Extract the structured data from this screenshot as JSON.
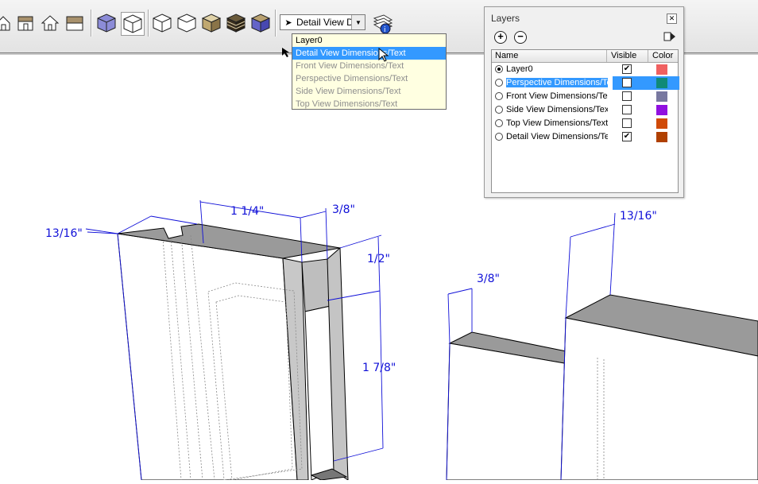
{
  "toolbar": {
    "icons": [
      "house-icon",
      "house-front-icon",
      "house-outline-icon",
      "house-roof-icon",
      "xray-cube-icon",
      "wireframe-cube-icon",
      "hidden-line-cube-icon",
      "hidden-line-cube-icon",
      "shaded-cube-icon",
      "shaded-textures-cube-icon",
      "monochrome-cube-icon",
      "layer-manager-icon"
    ],
    "layer_select_value": "Detail View Di"
  },
  "layer_dropdown": {
    "options": [
      "Layer0",
      "Detail View Dimensions/Text",
      "Front View Dimensions/Text",
      "Perspective Dimensions/Text",
      "Side View Dimensions/Text",
      "Top View Dimensions/Text"
    ],
    "selected": "Detail View Dimensions/Text"
  },
  "layers_window": {
    "title": "Layers",
    "columns": [
      "Name",
      "Visible",
      "Color"
    ],
    "add_icon": "plus-circle-icon",
    "remove_icon": "minus-circle-icon",
    "details_icon": "details-arrow-icon",
    "rows": [
      {
        "name": "Layer0",
        "active": true,
        "visible": true,
        "color": "#f06060"
      },
      {
        "name": "Perspective Dimensions/Te",
        "active": false,
        "visible": false,
        "color": "#0f8a78"
      },
      {
        "name": "Front View Dimensions/Tex",
        "active": false,
        "visible": false,
        "color": "#7878a0"
      },
      {
        "name": "Side View Dimensions/Text",
        "active": false,
        "visible": false,
        "color": "#9010e0"
      },
      {
        "name": "Top View Dimensions/Text",
        "active": false,
        "visible": false,
        "color": "#d04a08"
      },
      {
        "name": "Detail View Dimensions/Tex",
        "active": false,
        "visible": true,
        "color": "#b04000"
      }
    ]
  },
  "dimensions": [
    "13/16\"",
    "1 1/4\"",
    "3/8\"",
    "1/2\"",
    "1 7/8\"",
    "3/8\"",
    "13/16\""
  ]
}
